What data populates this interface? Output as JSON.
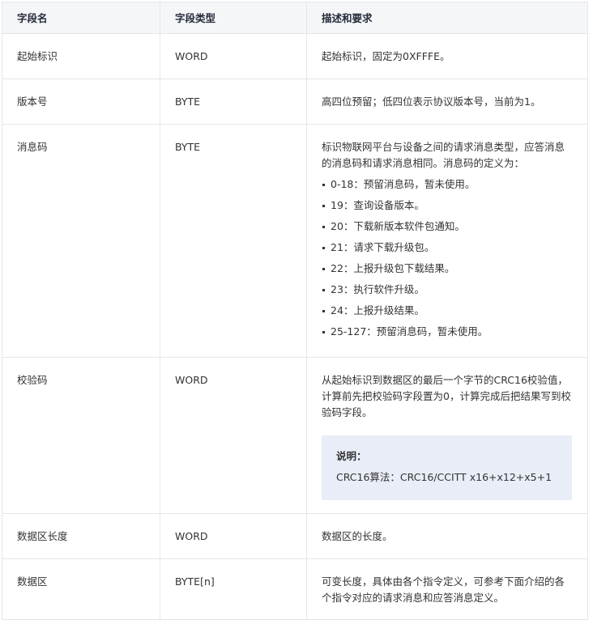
{
  "table": {
    "headers": [
      "字段名",
      "字段类型",
      "描述和要求"
    ],
    "rows": [
      {
        "name": "起始标识",
        "type": "WORD",
        "desc": "起始标识，固定为0XFFFE。"
      },
      {
        "name": "版本号",
        "type": "BYTE",
        "desc": "高四位预留；低四位表示协议版本号，当前为1。"
      },
      {
        "name": "消息码",
        "type": "BYTE",
        "desc": "标识物联网平台与设备之间的请求消息类型，应答消息的消息码和请求消息相同。消息码的定义为：",
        "items": [
          "0-18：预留消息码，暂未使用。",
          "19：查询设备版本。",
          "20：下载新版本软件包通知。",
          "21：请求下载升级包。",
          "22：上报升级包下载结果。",
          "23：执行软件升级。",
          "24：上报升级结果。",
          "25-127：预留消息码，暂未使用。"
        ]
      },
      {
        "name": "校验码",
        "type": "WORD",
        "desc": "从起始标识到数据区的最后一个字节的CRC16校验值，计算前先把校验码字段置为0，计算完成后把结果写到校验码字段。",
        "note": {
          "title": "说明：",
          "text": "CRC16算法：CRC16/CCITT x16+x12+x5+1"
        }
      },
      {
        "name": "数据区长度",
        "type": "WORD",
        "desc": "数据区的长度。"
      },
      {
        "name": "数据区",
        "type": "BYTE[n]",
        "desc": "可变长度，具体由各个指令定义，可参考下面介绍的各个指令对应的请求消息和应答消息定义。"
      }
    ]
  }
}
